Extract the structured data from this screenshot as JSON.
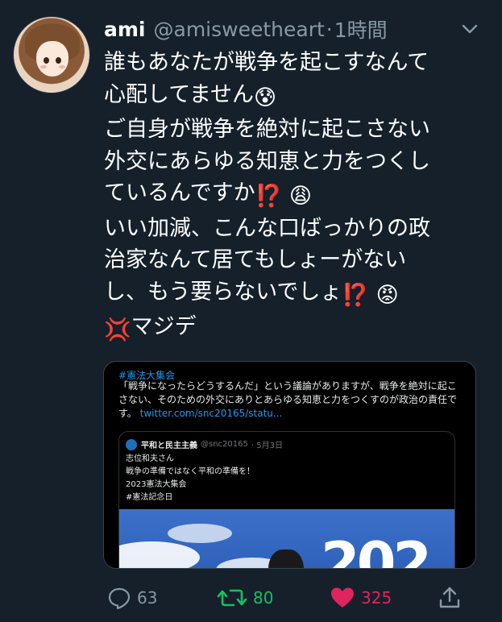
{
  "tweet": {
    "display_name": "ami",
    "handle": "@amisweetheart",
    "separator": "·",
    "time": "1時間",
    "lines": [
      "誰もあなたが戦争を起こすなんて",
      "心配してません",
      "ご自身が戦争を絶対に起こさない",
      "外交にあらゆる知恵と力をつくし",
      "ているんですか",
      "いい加減、こんな口ばっかりの政",
      "治家なんて居てもしょーがない",
      "し、もう要らないでしょ",
      "マジデ"
    ],
    "emojis": {
      "cold_sweat": "😰",
      "interrobang": "⁉️",
      "weary": "😩",
      "angry": "😡",
      "anger_symbol": "💢"
    }
  },
  "quote": {
    "hashtag": "#憲法大集会",
    "text": "「戦争になったらどうするんだ」という議論がありますが、戦争を絶対に起こさない、そのための外交にありとあらゆる知恵と力をつくすのが政治の責任です。",
    "link": "twitter.com/snc20165/statu...",
    "inner": {
      "name": "平和と民主主義",
      "handle": "@snc20165",
      "date": "· 5月3日",
      "lines": [
        "志位和夫さん",
        "戦争の準備ではなく平和の準備を！",
        "2023憲法大集会",
        "#憲法記念日"
      ],
      "image_text": "202"
    }
  },
  "actions": {
    "reply_count": "63",
    "retweet_count": "80",
    "like_count": "325"
  },
  "colors": {
    "background": "#15202b",
    "secondary_text": "#8899a6",
    "retweet_active": "#17bf63",
    "like_active": "#e0245e",
    "link": "#1d9bf0"
  },
  "icons": [
    "chevron-down-icon",
    "reply-icon",
    "retweet-icon",
    "heart-icon",
    "share-icon"
  ]
}
